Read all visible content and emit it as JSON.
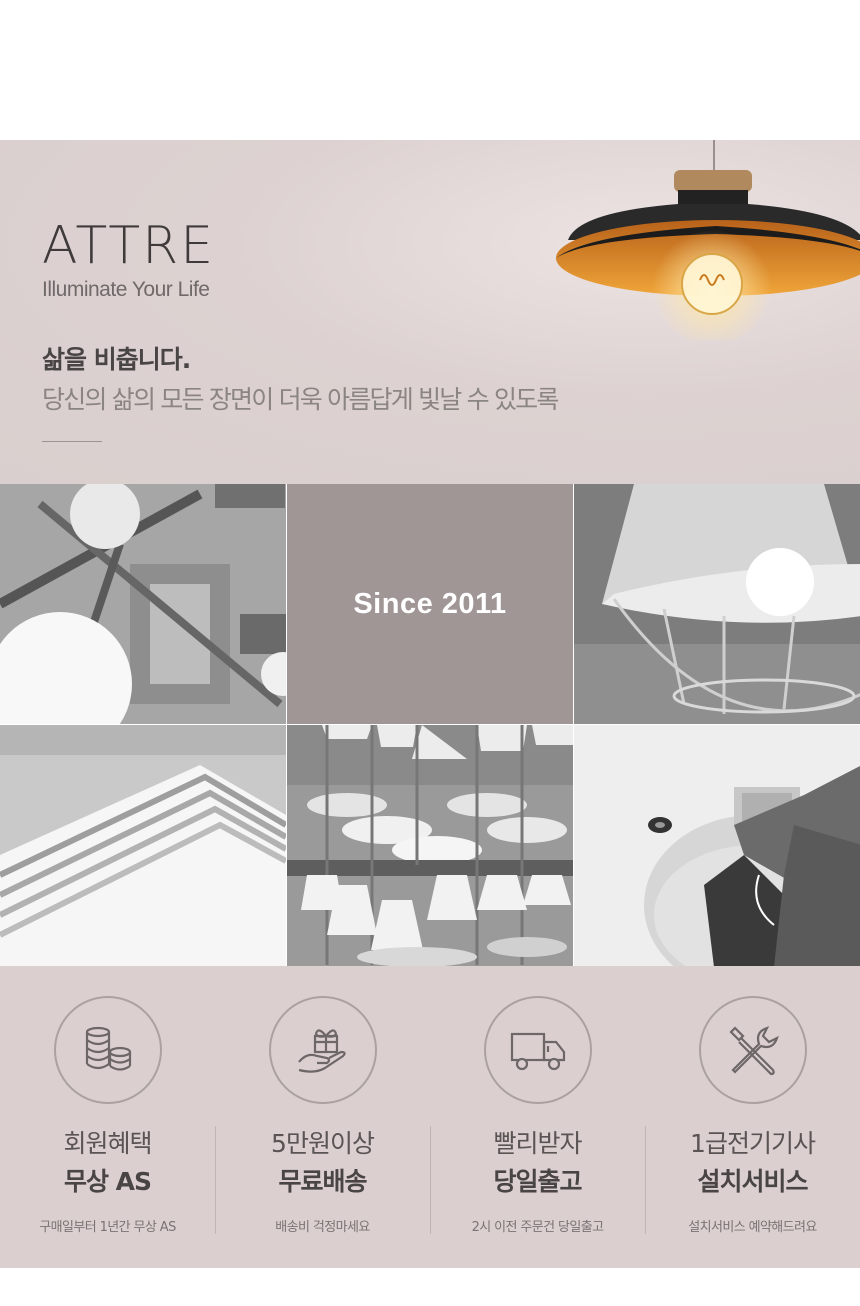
{
  "brand": {
    "logo": "ATTRE",
    "tagline": "Illuminate Your Life"
  },
  "hero": {
    "title": "삶을 비춥니다.",
    "subtitle": "당신의 삶의 모든 장면이 더욱 아름답게 빛날 수 있도록"
  },
  "gallery": {
    "since": "Since 2011"
  },
  "features": [
    {
      "title": "회원혜택",
      "strong": "무상 AS",
      "desc": "구매일부터 1년간 무상 AS",
      "icon": "coins-icon"
    },
    {
      "title": "5만원이상",
      "strong": "무료배송",
      "desc": "배송비 걱정마세요",
      "icon": "gift-hand-icon"
    },
    {
      "title": "빨리받자",
      "strong": "당일출고",
      "desc": "2시 이전 주문건 당일출고",
      "icon": "truck-icon"
    },
    {
      "title": "1급전기기사",
      "strong": "설치서비스",
      "desc": "설치서비스 예약해드려요",
      "icon": "tools-icon"
    }
  ],
  "colors": {
    "hero_bg": "#d9cfce",
    "since_tile": "#a09696",
    "features_bg": "#dbd0cf",
    "lamp_inner": "#e8932a"
  }
}
